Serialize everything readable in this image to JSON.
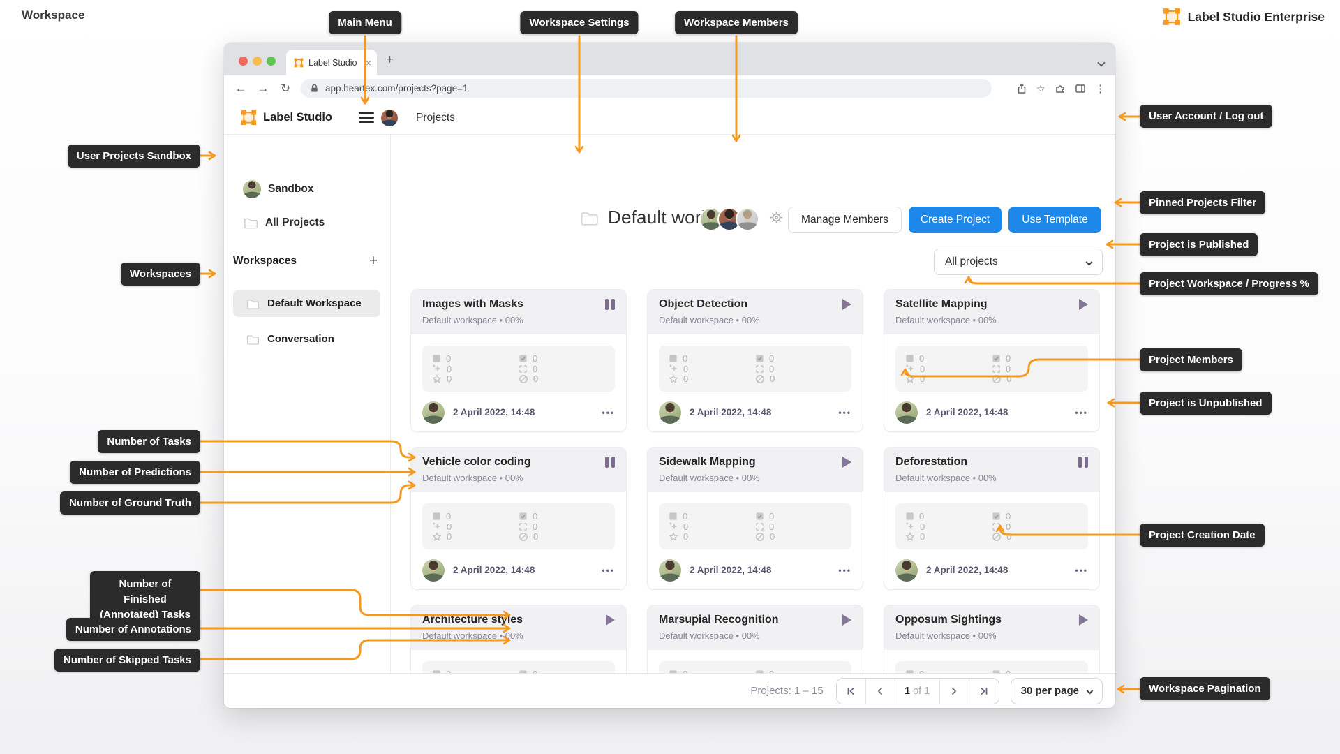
{
  "colors": {
    "accent_orange": "#F5991F",
    "primary_blue": "#1D87EA",
    "callout_bg": "#2B2B2C",
    "status_purple": "#7D6B92"
  },
  "icons": {
    "close": "×",
    "new_tab": "+",
    "add": "+",
    "overflow_dots": "⋮",
    "star": "☆",
    "back": "←",
    "forward": "→",
    "reload": "↻",
    "menu_dots": "•••",
    "tab_close": "×"
  },
  "page": {
    "corner_label": "Workspace",
    "brand_name": "Label Studio Enterprise"
  },
  "browser": {
    "tab_title": "Label Studio",
    "url": "app.heartex.com/projects?page=1"
  },
  "annotations": {
    "main_menu": "Main Menu",
    "workspace_settings": "Workspace Settings",
    "workspace_members": "Workspace Members",
    "user_account": "User Account / Log out",
    "user_projects_sandbox": "User Projects Sandbox",
    "pinned_projects_filter": "Pinned Projects Filter",
    "project_is_published": "Project is Published",
    "project_workspace_progress": "Project Workspace / Progress %",
    "workspaces": "Workspaces",
    "project_members": "Project Members",
    "project_is_unpublished": "Project is Unpublished",
    "number_of_tasks": "Number of Tasks",
    "number_of_predictions": "Number of Predictions",
    "number_of_ground_truth": "Number of Ground Truth",
    "number_of_finished_tasks": "Number of Finished (Annotated) Tasks",
    "number_of_annotations": "Number of Annotations",
    "number_of_skipped_tasks": "Number of Skipped Tasks",
    "project_creation_date": "Project Creation Date",
    "workspace_pagination": "Workspace Pagination"
  },
  "app": {
    "sidebar": {
      "brand": "Label Studio",
      "sandbox_label": "Sandbox",
      "all_projects_label": "All Projects",
      "workspaces_title": "Workspaces",
      "workspaces": [
        {
          "label": "Default Workspace",
          "selected": true
        },
        {
          "label": "Conversation",
          "selected": false
        }
      ]
    },
    "header": {
      "page_title": "Projects"
    },
    "workspace": {
      "title": "Default workspace",
      "manage_members_label": "Manage Members",
      "create_project_label": "Create Project",
      "use_template_label": "Use Template",
      "filter_label": "All projects"
    },
    "projects": {
      "defaults": {
        "subtitle": "Default workspace • 00%",
        "date": "2 April 2022, 14:48",
        "stats": {
          "tasks": "0",
          "finished": "0",
          "predictions": "0",
          "annotations": "0",
          "ground_truth": "0",
          "skipped": "0"
        }
      },
      "items": [
        {
          "title": "Images with Masks",
          "status": "paused"
        },
        {
          "title": "Object Detection",
          "status": "published"
        },
        {
          "title": "Satellite Mapping",
          "status": "published"
        },
        {
          "title": "Vehicle color coding",
          "status": "paused"
        },
        {
          "title": "Sidewalk Mapping",
          "status": "published"
        },
        {
          "title": "Deforestation",
          "status": "paused"
        },
        {
          "title": "Architecture styles",
          "status": "published"
        },
        {
          "title": "Marsupial Recognition",
          "status": "published"
        },
        {
          "title": "Opposum Sightings",
          "status": "published"
        }
      ]
    },
    "pagination": {
      "summary": "Projects: 1 – 15",
      "current_page": "1",
      "of_label": "of 1",
      "per_page": "30 per page"
    }
  }
}
